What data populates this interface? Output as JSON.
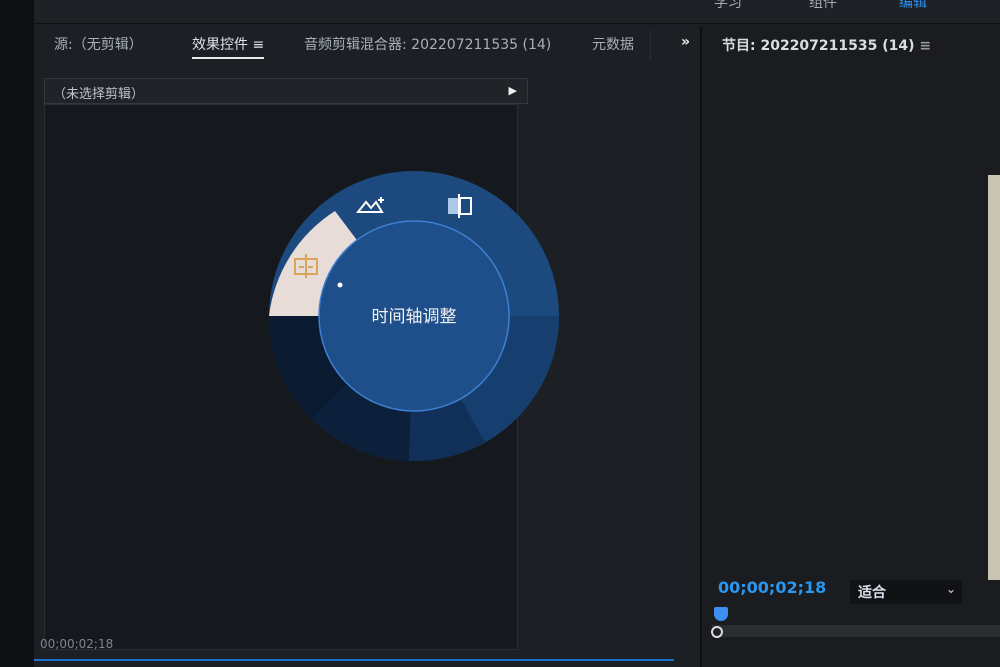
{
  "topbar": {
    "workspaces": [
      "学习",
      "组件",
      "编辑"
    ]
  },
  "source_panel": {
    "tabs": [
      {
        "label": "源:（无剪辑）"
      },
      {
        "label": "效果控件",
        "active": true,
        "menu_icon": "hamburger-icon"
      },
      {
        "label": "音频剪辑混合器: 202207211535 (14)"
      },
      {
        "label": "元数据"
      }
    ],
    "overflow_icon": "double-chevron-right-icon",
    "clip_label": "（未选择剪辑）",
    "timecode": "00;00;02;18"
  },
  "program_panel": {
    "title": "节目: 202207211535 (14)",
    "timecode": "00;00;02;18",
    "zoom_select": "适合"
  },
  "dial": {
    "center_label": "时间轴调整",
    "icons": [
      "timeline-adjust-icon",
      "image-enhance-icon",
      "split-view-icon"
    ],
    "colors": {
      "selected": "#e8dcd8",
      "ring": "#1d4a7e",
      "center": "#1f4f8a",
      "icon_accent": "#d8a55a"
    }
  }
}
